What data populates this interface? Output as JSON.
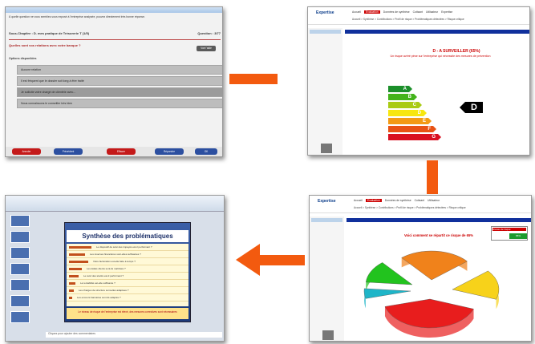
{
  "screen1": {
    "question_text": "À quelle question ne vous semblez-vous exposé à l'entreprise analysée, pouvez directement très bonne réponse.",
    "chapter": "Sous-Chapitre : D. mes pratique de Trésorerie T (1/5)",
    "question_number": "Question : 3/77",
    "prompt": "Quelles sont vos relations avec votre banque ?",
    "help_button": "Voir l'aide",
    "options_label": "Options disponibles",
    "options": [
      "Aucune relation",
      "Il est fréquent que le dossier soit long à être traité",
      "Je sollicite votre chargé de clientèle avec...",
      "Nous connaissons le conseiller très bien"
    ],
    "buttons": [
      "Annuler",
      "Précédent",
      "Effacer",
      "Répondre",
      "OK"
    ]
  },
  "screen2": {
    "logo": "Expertise",
    "menu": [
      "Accueil",
      "Evaluation",
      "Données de synthèse",
      "Cotisant",
      "Utilisateur",
      "Expertise"
    ],
    "submenu": "Accueil > Synthèse > Contributions > Profil de risque > Problématiques détectées > Risque critique",
    "bluebar": "Évaluation de l'entreprise     Résultat de l'évaluation",
    "headline": "D - A SURVEILLER (65%)",
    "subheadline": "Un risque avéré pèse sur l'entreprise qui nécessite des mesures de prévention",
    "grades": [
      "A",
      "B",
      "C",
      "D",
      "E",
      "F",
      "G"
    ],
    "grade_colors": [
      "#1b8f2a",
      "#43b31b",
      "#a9cb14",
      "#f7e70f",
      "#f39a13",
      "#e85213",
      "#d90f1f"
    ],
    "current_grade": "D"
  },
  "screen3": {
    "slide_title": "Synthèse des problématiques",
    "rows": [
      "Le dispositif de suivi des impayés est-il performant ?",
      "Les réserves financières sont-elles suffisantes ?",
      "Votre facturation est-elle faite à temps ?",
      "Les délais clients sont-ils maîtrisés ?",
      "Le suivi des stocks est-il performant ?",
      "La rentabilité est-elle suffisante ?",
      "Les charges de structure sont-elles adaptées ?",
      "Les encours bancaires sont-ils adaptés ?"
    ],
    "footer": "Le niveau de risque de l'entreprise est élevé, des mesures correctives sont nécessaires",
    "notes": "Cliquez pour ajouter des commentaires"
  },
  "screen4": {
    "chart_title": "Voici comment se répartit ce risque de 65%",
    "legend_label": "Niveau de risque",
    "legend_value": "65%",
    "chart_data": {
      "type": "pie",
      "title": "Voici comment se répartit ce risque de 65%",
      "slice_colors": [
        "#e81d1d",
        "#f7d21a",
        "#f0821b",
        "#22c31e",
        "#1eb5c8"
      ]
    }
  },
  "arrows_color": "#f35a0f"
}
